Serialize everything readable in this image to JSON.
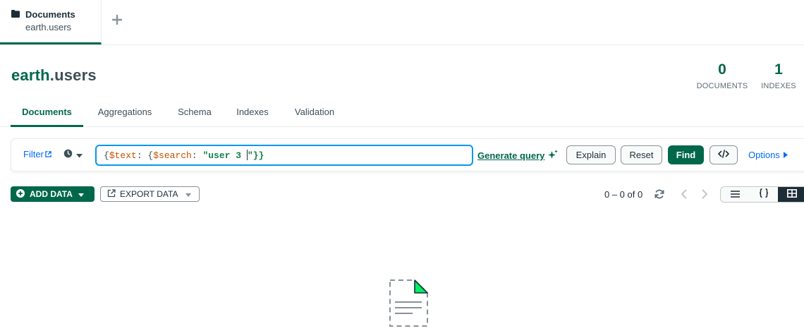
{
  "workspace_tab": {
    "title": "Documents",
    "subtitle": "earth.users"
  },
  "header": {
    "database": "earth",
    "separator": ".",
    "collection": "users",
    "documents_count": "0",
    "documents_label": "DOCUMENTS",
    "indexes_count": "1",
    "indexes_label": "INDEXES"
  },
  "tabs": [
    "Documents",
    "Aggregations",
    "Schema",
    "Indexes",
    "Validation"
  ],
  "active_tab": "Documents",
  "query_bar": {
    "filter_label": "Filter",
    "query_parts": [
      "{",
      "$text",
      ": {",
      "$search",
      ": ",
      "\"user 3 ",
      "\"}}"
    ],
    "generate_query_label": "Generate query",
    "explain_label": "Explain",
    "reset_label": "Reset",
    "find_label": "Find",
    "options_label": "Options"
  },
  "toolbar": {
    "add_data_label": "ADD DATA",
    "export_data_label": "EXPORT DATA",
    "pagination_text": "0 – 0 of 0"
  },
  "view_modes": [
    "list",
    "json",
    "table"
  ],
  "active_view": "table",
  "colors": {
    "brand": "#00684a",
    "link": "#016bf8",
    "focus": "#0498ec",
    "empty_icon_accent": "#00ed64"
  },
  "icons": [
    "folder-icon",
    "plus-icon",
    "external-link-icon",
    "clock-icon",
    "sparkle-icon",
    "code-icon",
    "caret-right-icon",
    "plus-circle-icon",
    "export-icon",
    "refresh-icon",
    "chevron-left-icon",
    "chevron-right-icon",
    "list-view-icon",
    "json-view-icon",
    "table-view-icon",
    "empty-document-icon"
  ]
}
